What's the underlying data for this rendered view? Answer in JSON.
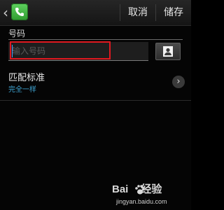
{
  "action_bar": {
    "cancel_label": "取消",
    "save_label": "储存"
  },
  "phone_field": {
    "label": "号码",
    "placeholder": "输入号码",
    "value": ""
  },
  "match_criteria": {
    "title": "匹配标准",
    "value": "完全一样"
  },
  "watermark": {
    "brand_left": "Bai",
    "brand_right": "经验",
    "url": "jingyan.baidu.com"
  },
  "colors": {
    "highlight_border": "#e0181f",
    "accent_blue": "#3fa7d6",
    "phone_icon_green": "#2f9b2f"
  },
  "icons": {
    "back": "chevron-left-icon",
    "app": "phone-icon",
    "contact": "contact-person-icon",
    "chevron": "chevron-right-icon"
  }
}
